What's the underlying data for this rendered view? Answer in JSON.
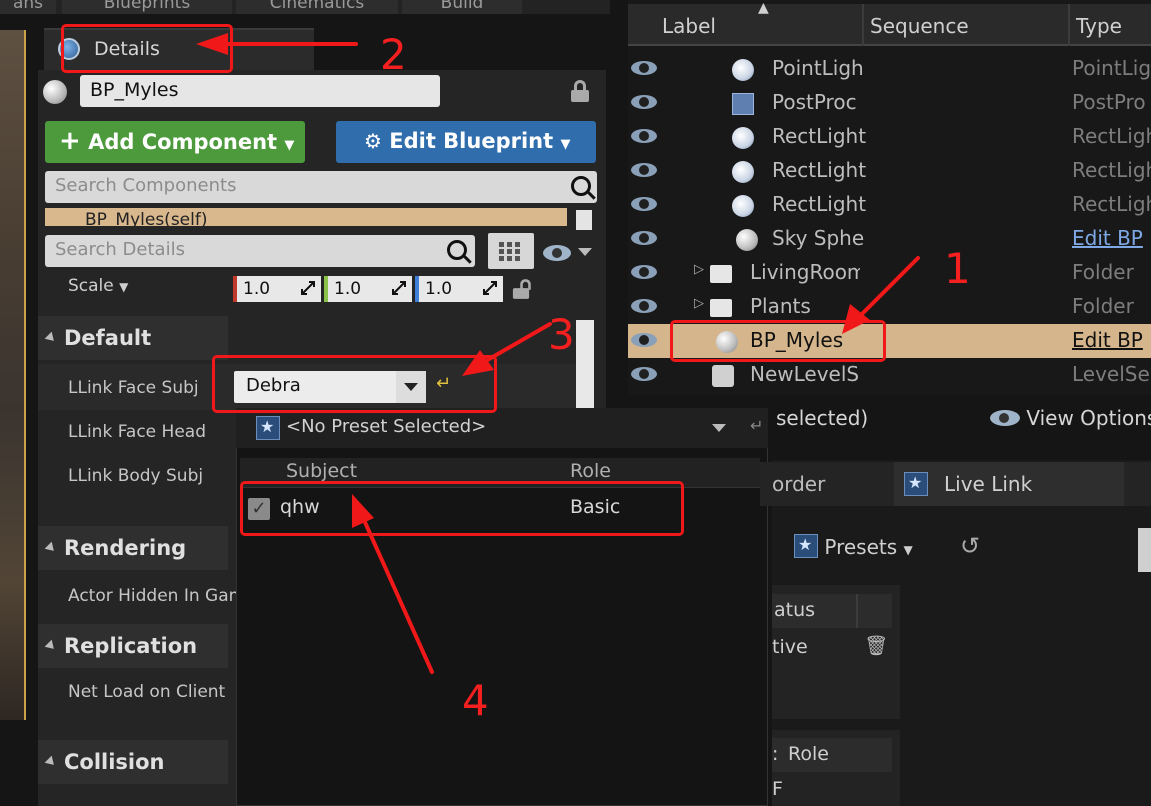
{
  "toolbar": {
    "tabs": [
      "ans",
      "Blueprints",
      "Cinematics",
      "Build"
    ]
  },
  "details": {
    "tab_label": "Details",
    "actor_name": "BP_Myles",
    "add_component": "Add Component",
    "edit_blueprint": "Edit Blueprint",
    "search_components_placeholder": "Search Components",
    "component_row": "BP_Myles(self)",
    "search_details_placeholder": "Search Details",
    "scale_label": "Scale",
    "scale_values": [
      "1.0",
      "1.0",
      "1.0"
    ],
    "categories": {
      "default": "Default",
      "rendering": "Rendering",
      "replication": "Replication",
      "collision": "Collision"
    },
    "properties": {
      "face_subj": "LLink Face Subj",
      "face_head": "LLink Face Head",
      "body_subj": "LLink Body Subj",
      "actor_hidden": "Actor Hidden In Gam",
      "net_load": "Net Load on Client"
    },
    "face_subj_value": "Debra"
  },
  "livelink_popup": {
    "preset": "<No Preset Selected>",
    "col_subject": "Subject",
    "col_role": "Role",
    "rows": [
      {
        "subject": "qhw",
        "role": "Basic"
      }
    ]
  },
  "outliner": {
    "col_label": "Label",
    "col_sequence": "Sequence",
    "col_type": "Type",
    "rows": [
      {
        "name": "PointLigh",
        "type": "PointLig",
        "icon": "point-light-icon"
      },
      {
        "name": "PostProc",
        "type": "PostPro",
        "icon": "post-process-icon"
      },
      {
        "name": "RectLight",
        "type": "RectLigh",
        "icon": "rect-light-icon"
      },
      {
        "name": "RectLight",
        "type": "RectLigh",
        "icon": "rect-light-icon"
      },
      {
        "name": "RectLight",
        "type": "RectLigh",
        "icon": "rect-light-icon"
      },
      {
        "name": "Sky Sphe",
        "type": "Edit BP",
        "icon": "sphere-icon"
      },
      {
        "name": "LivingRoom",
        "type": "Folder",
        "icon": "folder-icon"
      },
      {
        "name": "Plants",
        "type": "Folder",
        "icon": "folder-icon"
      },
      {
        "name": "BP_Myles",
        "type": "Edit BP",
        "icon": "sphere-icon"
      },
      {
        "name": "NewLevelSe",
        "type": "LevelSe",
        "icon": "level-sequence-icon"
      }
    ],
    "footer_selected": "selected)",
    "view_options": "View Options"
  },
  "livelink_panel": {
    "tab_prev": "order",
    "tab_label": "Live Link",
    "presets": "Presets",
    "status_head": "atus",
    "status_value": "tive",
    "role_head": "Role",
    "role_sub": "F"
  },
  "annotations": {
    "n1": "1",
    "n2": "2",
    "n3": "3",
    "n4": "4",
    "color": "#f01818"
  }
}
